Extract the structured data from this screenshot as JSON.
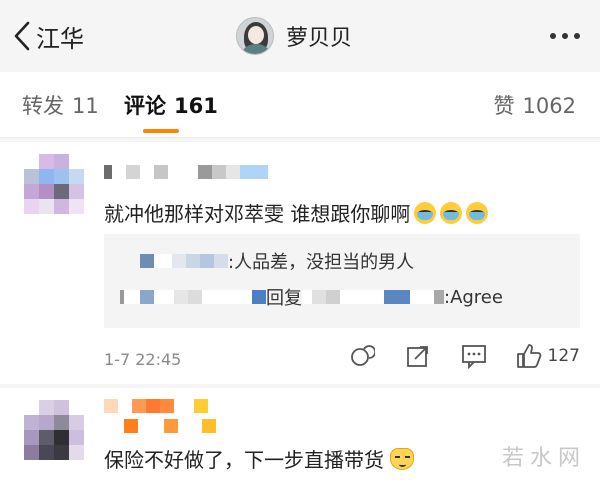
{
  "header": {
    "back_label": "江华",
    "title": "萝贝贝"
  },
  "tabs": {
    "repost_label": "转发",
    "repost_count": "11",
    "comment_label": "评论",
    "comment_count": "161",
    "like_label": "赞",
    "like_count": "1062"
  },
  "comments": [
    {
      "text": "就冲他那样对邓萃雯 谁想跟你聊啊",
      "replies": [
        {
          "text": ":人品差，没担当的男人"
        },
        {
          "reply_word": "回复",
          "tail": ":Agree"
        }
      ],
      "timestamp": "1-7 22:45",
      "like_count": "127"
    },
    {
      "text": "保险不好做了，下一步直播带货"
    }
  ],
  "watermark": "若水网",
  "colors": {
    "accent": "#ff8200",
    "header_bg": "#f5f5f5",
    "reply_bg": "#f4f4f4",
    "meta_text": "#8a8a8a"
  },
  "icons": [
    "chevron-left-icon",
    "more-icon",
    "retweet-icon",
    "share-icon",
    "comment-icon",
    "thumbs-up-icon",
    "crying-emoji-icon",
    "cat-emoji-icon"
  ]
}
